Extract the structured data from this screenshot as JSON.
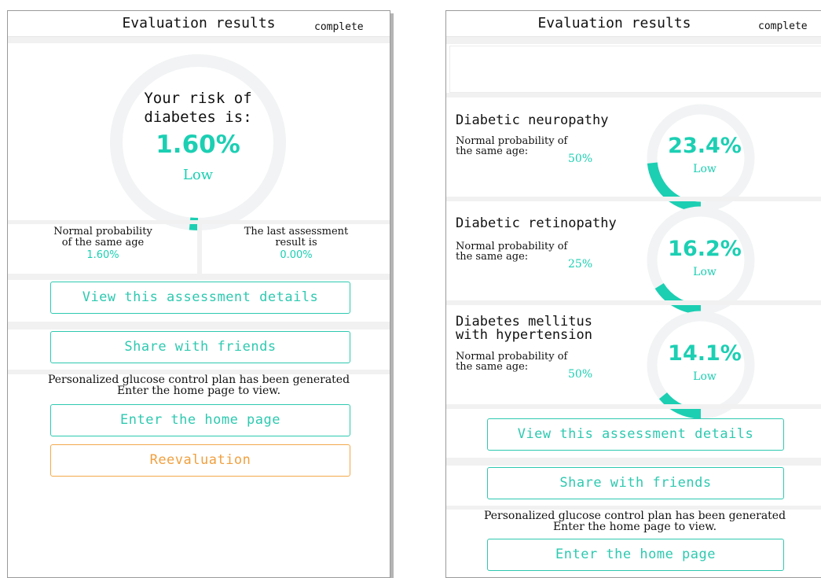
{
  "colors": {
    "accent": "#1ccfb3",
    "ring_track": "#f1f3f4",
    "button_border": "#2ec9b0",
    "reevaluate_orange": "#f0a040"
  },
  "left_screen": {
    "header": {
      "title": "Evaluation results",
      "complete_label": "complete"
    },
    "risk": {
      "line1": "Your risk of",
      "line2": "diabetes is:",
      "value": "1.60%",
      "fraction": 0.016,
      "level": "Low"
    },
    "normal_probability": {
      "label_line1": "Normal probability",
      "label_line2": "of the same age",
      "value": "1.60%"
    },
    "last_assessment": {
      "label_line1": "The last assessment",
      "label_line2": "result is",
      "value": "0.00%"
    },
    "buttons": {
      "view_details": "View this assessment details",
      "share": "Share with friends",
      "enter_home": "Enter the home page",
      "reevaluation": "Reevaluation"
    },
    "plan_note": {
      "line1": "Personalized glucose control plan has been generated",
      "line2": "Enter the home page to view."
    }
  },
  "right_screen": {
    "header": {
      "title": "Evaluation results",
      "complete_label": "complete"
    },
    "cards": [
      {
        "title_line1": "Diabetic neuropathy",
        "title_line2": "",
        "normal_label_line1": "Normal probability of",
        "normal_label_line2": "the same age:",
        "normal_value": "50%",
        "value": "23.4%",
        "fraction": 0.234,
        "level": "Low"
      },
      {
        "title_line1": "Diabetic retinopathy",
        "title_line2": "",
        "normal_label_line1": "Normal probability of",
        "normal_label_line2": "the same age:",
        "normal_value": "25%",
        "value": "16.2%",
        "fraction": 0.162,
        "level": "Low"
      },
      {
        "title_line1": "Diabetes mellitus",
        "title_line2": "with hypertension",
        "normal_label_line1": "Normal probability of",
        "normal_label_line2": "the same age:",
        "normal_value": "50%",
        "value": "14.1%",
        "fraction": 0.141,
        "level": "Low"
      }
    ],
    "buttons": {
      "view_details": "View this assessment details",
      "share": "Share with friends",
      "enter_home": "Enter the home page"
    },
    "plan_note": {
      "line1": "Personalized glucose control plan has been generated",
      "line2": "Enter the home page to view."
    }
  }
}
